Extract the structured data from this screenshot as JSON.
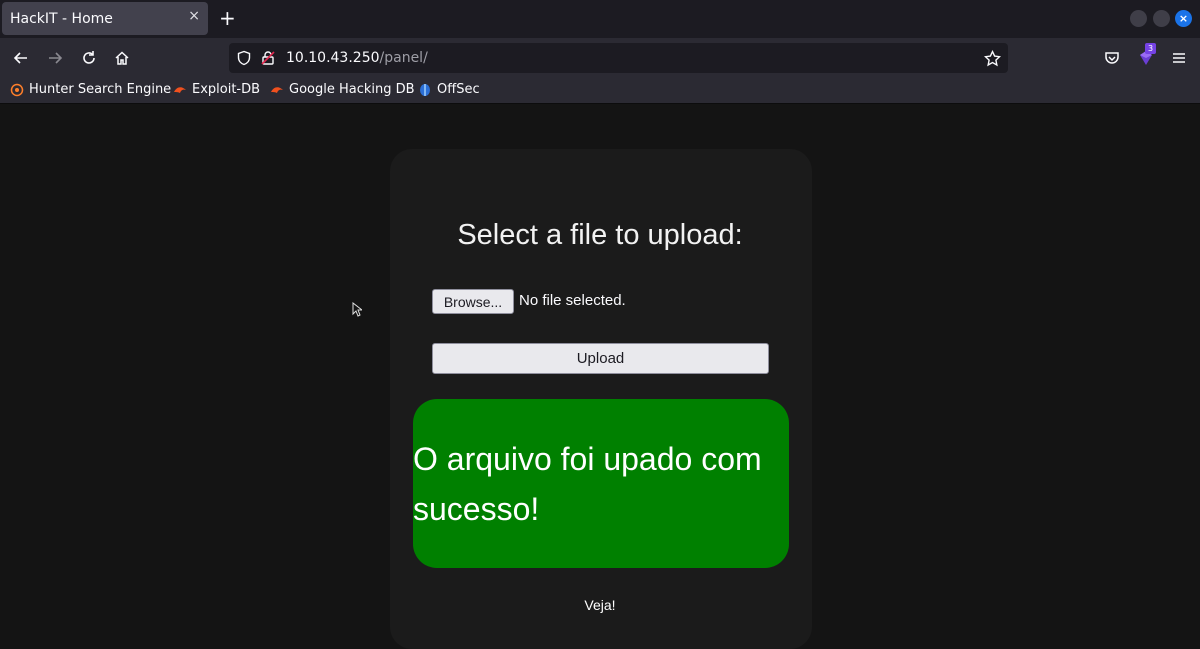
{
  "tab": {
    "title": "HackIT - Home",
    "close": "×",
    "new_tab": "+"
  },
  "window": {
    "close": "×"
  },
  "address": {
    "host": "10.10.43.250",
    "path": "/panel/"
  },
  "extensions": {
    "badge": "3"
  },
  "bookmarks": [
    {
      "label": "Hunter Search Engine",
      "icon": "hunter-icon"
    },
    {
      "label": "Exploit-DB",
      "icon": "exploit-db-icon"
    },
    {
      "label": "Google Hacking DB",
      "icon": "ghdb-icon"
    },
    {
      "label": "OffSec",
      "icon": "offsec-icon"
    }
  ],
  "page": {
    "title": "Select a file to upload:",
    "browse_label": "Browse...",
    "file_status": "No file selected.",
    "upload_label": "Upload",
    "success_message": "O arquivo foi upado com sucesso!",
    "footer_text": "Veja!"
  },
  "colors": {
    "success_bg": "#008000",
    "page_bg": "#141414",
    "card_bg": "#1b1b1b"
  }
}
